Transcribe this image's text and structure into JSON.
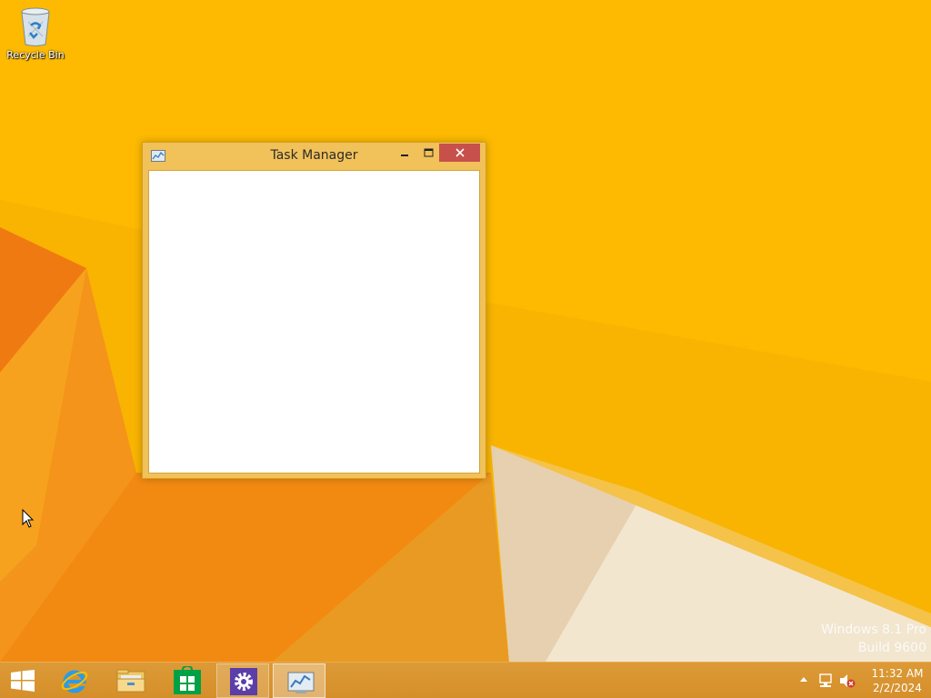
{
  "desktop": {
    "icons": [
      {
        "label": "Recycle Bin",
        "icon": "recycle-bin-icon"
      }
    ]
  },
  "window": {
    "title": "Task Manager",
    "app_icon": "task-manager-icon",
    "controls": {
      "minimize": "minimize-icon",
      "maximize": "maximize-icon",
      "close": "close-icon"
    }
  },
  "watermark": {
    "line1": "Windows 8.1 Pro",
    "line2": "Build 9600"
  },
  "taskbar": {
    "start": "windows-logo-icon",
    "pinned": [
      {
        "name": "Internet Explorer",
        "icon": "internet-explorer-icon"
      },
      {
        "name": "File Explorer",
        "icon": "file-explorer-icon"
      },
      {
        "name": "Store",
        "icon": "store-icon"
      },
      {
        "name": "Settings",
        "icon": "gear-icon"
      },
      {
        "name": "Task Manager",
        "icon": "task-manager-icon",
        "active": true
      }
    ],
    "tray": {
      "icons": [
        "show-hidden-icons-arrow-icon",
        "network-icon",
        "volume-muted-icon"
      ],
      "time": "11:32 AM",
      "date": "2/2/2024"
    }
  },
  "colors": {
    "wallpaper": "#f8b400",
    "taskbar": "#d8942f",
    "window_frame": "#f1c15a",
    "close_button": "#c7504b"
  }
}
